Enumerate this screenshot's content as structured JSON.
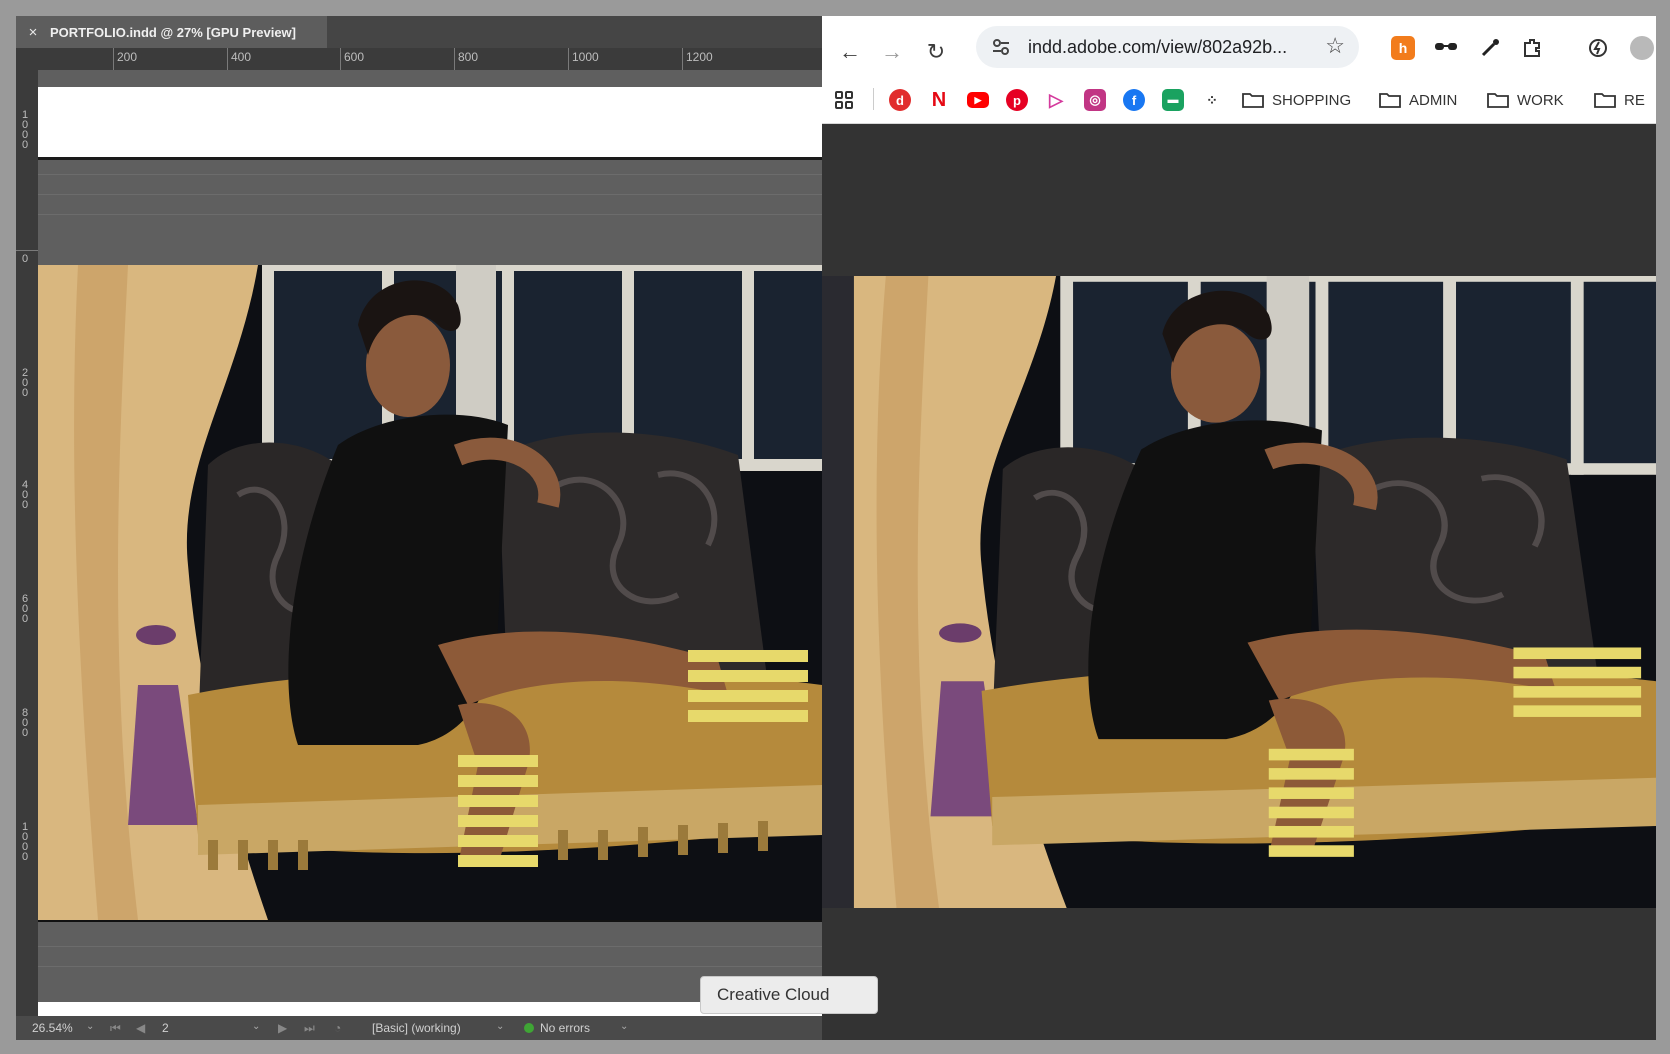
{
  "indesign": {
    "tab_close": "×",
    "doc_title": "PORTFOLIO.indd @ 27% [GPU Preview]",
    "ruler_h": [
      "200",
      "400",
      "600",
      "800",
      "1000",
      "1200"
    ],
    "ruler_v": [
      "1000",
      "0",
      "200",
      "400",
      "600",
      "800",
      "1000"
    ],
    "status": {
      "zoom": "26.54%",
      "page": "2",
      "preflight_profile": "[Basic] (working)",
      "errors": "No errors"
    }
  },
  "chrome": {
    "url": "indd.adobe.com/view/802a92b...",
    "bookmark_folders": [
      "SHOPPING",
      "ADMIN",
      "WORK",
      "RE"
    ],
    "bookmark_icons": [
      "apps-grid-icon",
      "d-icon",
      "netflix-icon",
      "youtube-icon",
      "pinterest-icon",
      "play-icon",
      "instagram-icon",
      "facebook-icon",
      "sheet-icon",
      "dots-icon"
    ],
    "tooltip": "Creative Cloud"
  },
  "colors": {
    "accent_orange": "#f27c1c",
    "status_green": "#3fa535"
  }
}
